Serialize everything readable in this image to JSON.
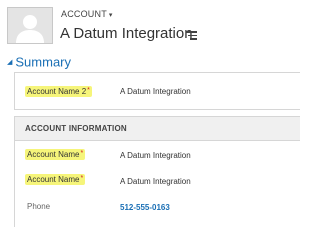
{
  "header": {
    "entity_label": "ACCOUNT",
    "entity_caret": "▾",
    "record_title": "A Datum Integration"
  },
  "summary": {
    "title": "Summary",
    "caret": "◢",
    "fields": [
      {
        "label": "Account Name 2",
        "required": "*",
        "value": "A Datum Integration"
      }
    ]
  },
  "account_information": {
    "title": "ACCOUNT INFORMATION",
    "fields": [
      {
        "label": "Account Name",
        "required": "*",
        "value": "A Datum Integration"
      },
      {
        "label": "Account Name",
        "required": "*",
        "value": "A Datum Integration"
      },
      {
        "label": "Phone",
        "required": "",
        "value": "512-555-0163"
      }
    ]
  },
  "colors": {
    "accent": "#1a6fb5",
    "highlight": "#f6f57a",
    "required": "#d21b1b"
  }
}
